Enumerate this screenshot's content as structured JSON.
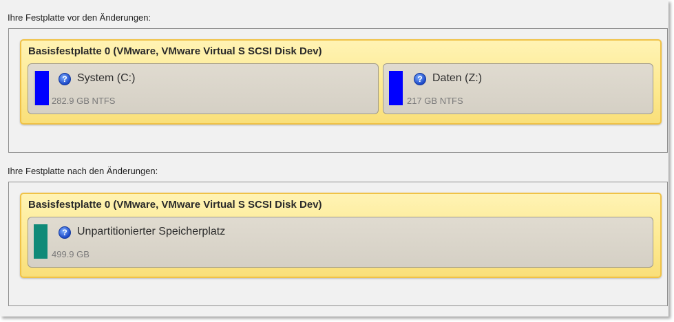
{
  "before": {
    "label": "Ihre Festplatte vor den Änderungen:",
    "disk_title": "Basisfestplatte 0 (VMware, VMware Virtual S SCSI Disk Dev)",
    "partitions": [
      {
        "name": "System (C:)",
        "info": "282.9 GB NTFS",
        "color": "#0000ff",
        "icon": "help-icon"
      },
      {
        "name": "Daten (Z:)",
        "info": "217 GB NTFS",
        "color": "#0000ff",
        "icon": "help-icon"
      }
    ]
  },
  "after": {
    "label": "Ihre Festplatte nach den Änderungen:",
    "disk_title": "Basisfestplatte 0 (VMware, VMware Virtual S SCSI Disk Dev)",
    "partitions": [
      {
        "name": "Unpartitionierter Speicherplatz",
        "info": "499.9 GB",
        "color": "#0f8a78",
        "icon": "help-icon"
      }
    ]
  },
  "colors": {
    "disk_border": "#f0c247",
    "disk_fill": "#fde98f",
    "partition_fill": "#d8d3c8"
  }
}
